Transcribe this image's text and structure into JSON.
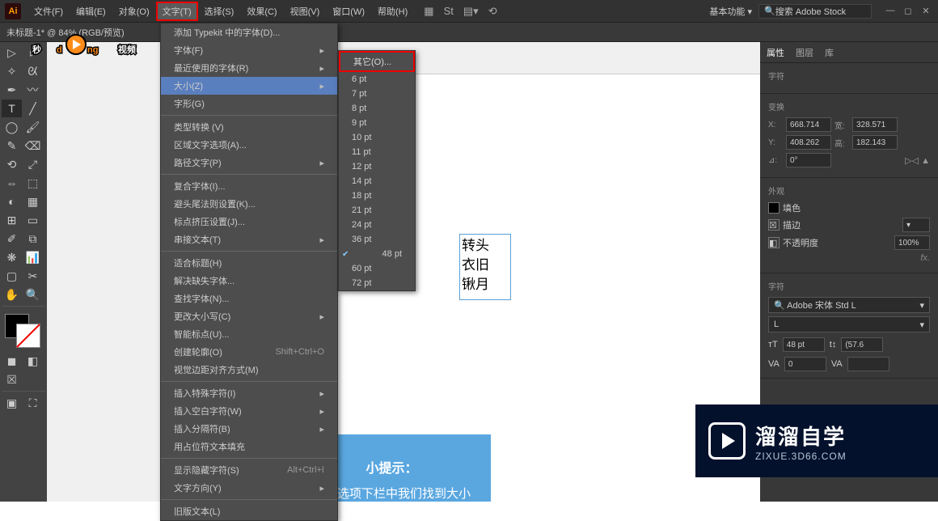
{
  "menubar": {
    "items": [
      "文件(F)",
      "编辑(E)",
      "对象(O)",
      "文字(T)",
      "选择(S)",
      "效果(C)",
      "视图(V)",
      "窗口(W)",
      "帮助(H)"
    ],
    "active_index": 3,
    "workspace": "基本功能",
    "search_placeholder": "搜索 Adobe Stock"
  },
  "doc_tab": "未标题-1* @ 84% (RGB/预览)",
  "type_menu": {
    "items": [
      {
        "label": "添加 Typekit 中的字体(D)..."
      },
      {
        "label": "字体(F)",
        "arrow": true
      },
      {
        "label": "最近使用的字体(R)",
        "arrow": true
      },
      {
        "label": "大小(Z)",
        "arrow": true,
        "hl": true
      },
      {
        "label": "字形(G)"
      },
      {
        "sep": true
      },
      {
        "label": "类型转换 (V)",
        "disabled": true
      },
      {
        "label": "区域文字选项(A)..."
      },
      {
        "label": "路径文字(P)",
        "arrow": true,
        "disabled": true
      },
      {
        "sep": true
      },
      {
        "label": "复合字体(I)..."
      },
      {
        "label": "避头尾法则设置(K)..."
      },
      {
        "label": "标点挤压设置(J)..."
      },
      {
        "label": "串接文本(T)",
        "arrow": true,
        "disabled": true
      },
      {
        "sep": true
      },
      {
        "label": "适合标题(H)"
      },
      {
        "label": "解决缺失字体...",
        "disabled": true
      },
      {
        "label": "查找字体(N)..."
      },
      {
        "label": "更改大小写(C)",
        "arrow": true
      },
      {
        "label": "智能标点(U)..."
      },
      {
        "label": "创建轮廓(O)",
        "shortcut": "Shift+Ctrl+O",
        "disabled": true
      },
      {
        "label": "视觉边距对齐方式(M)",
        "disabled": true
      },
      {
        "sep": true
      },
      {
        "label": "插入特殊字符(I)",
        "arrow": true
      },
      {
        "label": "插入空白字符(W)",
        "arrow": true
      },
      {
        "label": "插入分隔符(B)",
        "arrow": true
      },
      {
        "label": "用占位符文本填充"
      },
      {
        "sep": true
      },
      {
        "label": "显示隐藏字符(S)",
        "shortcut": "Alt+Ctrl+I"
      },
      {
        "label": "文字方向(Y)",
        "arrow": true
      },
      {
        "sep": true
      },
      {
        "label": "旧版文本(L)",
        "disabled": true
      }
    ]
  },
  "size_menu": {
    "other": "其它(O)...",
    "sizes": [
      "6 pt",
      "7 pt",
      "8 pt",
      "9 pt",
      "10 pt",
      "11 pt",
      "12 pt",
      "14 pt",
      "18 pt",
      "21 pt",
      "24 pt",
      "36 pt",
      "48 pt",
      "60 pt",
      "72 pt"
    ],
    "checked": "48 pt"
  },
  "canvas_text": [
    "转头",
    "衣旧",
    "锹月"
  ],
  "tip": {
    "title": "小提示：",
    "body": "文字选项下栏中我们找到大小"
  },
  "properties": {
    "tabs": [
      "属性",
      "图层",
      "库"
    ],
    "section1": "字符",
    "transform_title": "变换",
    "x": "668.714",
    "w": "328.571",
    "y": "408.262",
    "h": "182.143",
    "angle": "0°",
    "appearance_title": "外观",
    "fill": "填色",
    "stroke": "描边",
    "opacity_label": "不透明度",
    "opacity": "100%",
    "char_title": "字符",
    "font": "Adobe 宋体 Std L",
    "font_style": "L",
    "size": "48 pt",
    "leading": "(57.6",
    "kerning": "0"
  },
  "brand": {
    "cn": "溜溜自学",
    "en": "ZIXUE.3D66.COM"
  },
  "watermark": "秒懂视频"
}
